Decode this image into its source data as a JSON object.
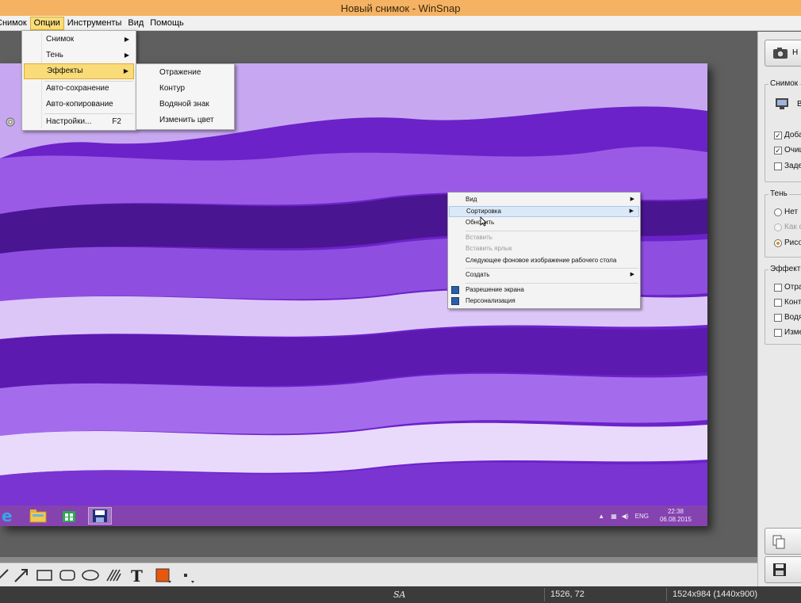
{
  "window": {
    "title": "Новый снимок - WinSnap"
  },
  "menubar": {
    "items": [
      "Снимок",
      "Опции",
      "Инструменты",
      "Вид",
      "Помощь"
    ],
    "active": "Опции"
  },
  "options_menu": {
    "items": [
      {
        "label": "Снимок",
        "submenu": true
      },
      {
        "label": "Тень",
        "submenu": true
      },
      {
        "label": "Эффекты",
        "submenu": true,
        "highlighted": true
      },
      {
        "label": "Авто-сохранение"
      },
      {
        "label": "Авто-копирование"
      },
      {
        "label": "Настройки...",
        "shortcut": "F2"
      }
    ],
    "effects_submenu": [
      "Отражение",
      "Контур",
      "Водяной знак",
      "Изменить цвет"
    ]
  },
  "desktop_context_menu": {
    "items": [
      {
        "label": "Вид",
        "submenu": true
      },
      {
        "label": "Сортировка",
        "submenu": true,
        "highlighted": true
      },
      {
        "label": "Обновить"
      },
      {
        "label": "Вставить",
        "disabled": true
      },
      {
        "label": "Вставить ярлык",
        "disabled": true
      },
      {
        "label": "Следующее фоновое изображение рабочего стола"
      },
      {
        "label": "Создать",
        "submenu": true
      },
      {
        "label": "Разрешение экрана",
        "icon": "display-icon"
      },
      {
        "label": "Персонализация",
        "icon": "personalize-icon"
      }
    ]
  },
  "taskbar": {
    "lang": "ENG",
    "time": "22:38",
    "date": "06.08.2015"
  },
  "right_panel": {
    "new_button_label": "Н",
    "snapshot_group": {
      "title": "Снимок",
      "mode_label": "В",
      "options": [
        {
          "label": "Доба",
          "checked": true
        },
        {
          "label": "Очищ",
          "checked": true
        },
        {
          "label": "Заде",
          "checked": false
        }
      ]
    },
    "shadow_group": {
      "title": "Тень",
      "options": [
        {
          "label": "Нет",
          "selected": false,
          "disabled": false
        },
        {
          "label": "Как с",
          "selected": false,
          "disabled": true
        },
        {
          "label": "Рисов",
          "selected": true,
          "disabled": false
        }
      ]
    },
    "effects_group": {
      "title": "Эффекты",
      "options": [
        {
          "label": "Отра",
          "checked": false
        },
        {
          "label": "Конт",
          "checked": false
        },
        {
          "label": "Водя",
          "checked": false
        },
        {
          "label": "Измен",
          "checked": false
        }
      ]
    }
  },
  "toolbar": {
    "tools": [
      "line-tool",
      "arrow-tool",
      "rectangle-tool",
      "rounded-rectangle-tool",
      "ellipse-tool",
      "hatch-tool",
      "text-tool",
      "color-picker",
      "line-width"
    ],
    "color": "#e8580c"
  },
  "statusbar": {
    "signature": "SA",
    "cursor": "1526, 72",
    "size": "1524x984 (1440x900)"
  },
  "colors": {
    "title_bar": "#f4b262",
    "menu_highlight": "#f9db78",
    "wallpaper": "#7b2ad9"
  }
}
